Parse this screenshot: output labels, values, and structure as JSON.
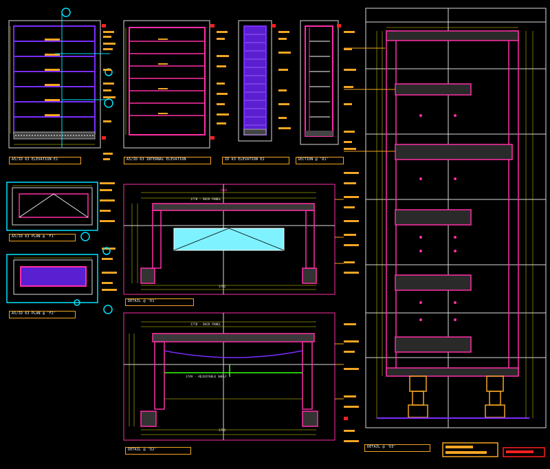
{
  "titles": [
    {
      "text": "A5/ID 63 ELEVATION E1"
    },
    {
      "text": "A5/ID 63 INTERNAL ELEVATION"
    },
    {
      "text": "ID 63 ELEVATION E2"
    },
    {
      "text": "SECTION @ 'D1'"
    },
    {
      "text": "A5/ID 63 PLAN @ 'F1'"
    },
    {
      "text": "A5/ID 63 PLAN @ 'F2'"
    },
    {
      "text": "DETAIL @ 'D1'"
    },
    {
      "text": "DETAIL @ 'D2'"
    },
    {
      "text": "DETAIL @ 'D3'"
    }
  ],
  "notes": {
    "back_panel_1": "1778 - BACK PANEL",
    "back_panel_2": "1778 - BACK PANEL",
    "adjustable_shelf": "1749 - ADJUSTABLE SHELF"
  },
  "dims": {
    "d1_top": "1800",
    "d1_bottom": "1782",
    "d2_bottom": "1782"
  },
  "colors": {
    "background": "#000000",
    "frame": "#ffffff",
    "accent_magenta": "#ff2fa8",
    "accent_orange": "#f5a623",
    "accent_yellow": "#e6e600",
    "accent_cyan": "#00e5ff",
    "accent_purple": "#7b2cff",
    "accent_green": "#39ff14",
    "accent_red": "#ff2020"
  }
}
